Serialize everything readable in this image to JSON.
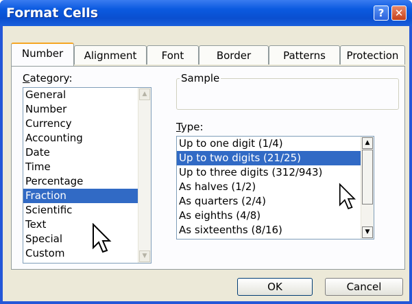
{
  "window": {
    "title": "Format Cells"
  },
  "titlebar_buttons": {
    "help": "?",
    "close": "✕"
  },
  "tabs": [
    "Number",
    "Alignment",
    "Font",
    "Border",
    "Patterns",
    "Protection"
  ],
  "active_tab": "Number",
  "category": {
    "label_prefix": "C",
    "label_rest": "ategory:",
    "items": [
      "General",
      "Number",
      "Currency",
      "Accounting",
      "Date",
      "Time",
      "Percentage",
      "Fraction",
      "Scientific",
      "Text",
      "Special",
      "Custom"
    ],
    "selected": "Fraction"
  },
  "sample": {
    "label": "Sample",
    "value": ""
  },
  "type": {
    "label_prefix": "T",
    "label_rest": "ype:",
    "items": [
      "Up to one digit (1/4)",
      "Up to two digits (21/25)",
      "Up to three digits (312/943)",
      "As halves (1/2)",
      "As quarters (2/4)",
      "As eighths (4/8)",
      "As sixteenths (8/16)"
    ],
    "selected": "Up to two digits (21/25)"
  },
  "buttons": {
    "ok": "OK",
    "cancel": "Cancel"
  },
  "colors": {
    "title_bar": "#0a4fd0",
    "selection": "#316ac5",
    "dialog_bg": "#ece9d8"
  }
}
